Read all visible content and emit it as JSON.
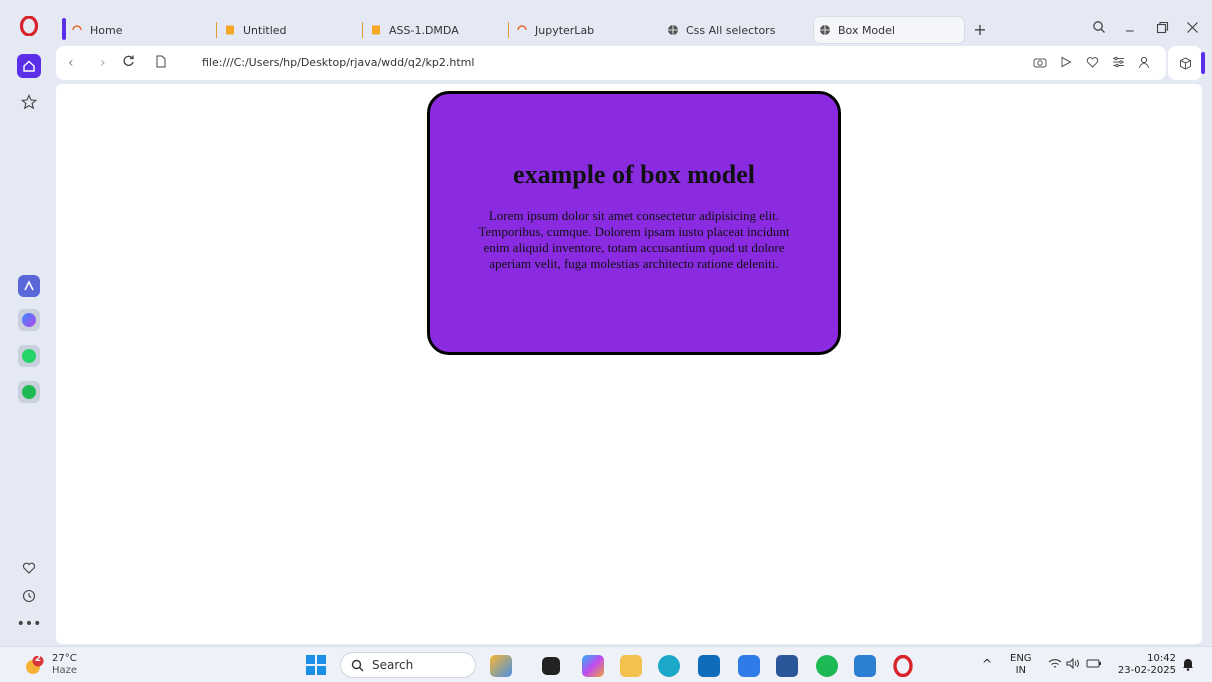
{
  "browser": {
    "tabs": [
      {
        "label": "Home"
      },
      {
        "label": "Untitled"
      },
      {
        "label": "ASS-1.DMDA"
      },
      {
        "label": "JupyterLab"
      },
      {
        "label": "Css All selectors"
      },
      {
        "label": "Box Model"
      }
    ],
    "new_tab": "+",
    "url": "file:///C:/Users/hp/Desktop/rjava/wdd/q2/kp2.html",
    "accent_color": "#5b2ee8"
  },
  "page": {
    "heading": "example of box model",
    "paragraph": "Lorem ipsum dolor sit amet consectetur adipisicing elit. Temporibus, cumque. Dolorem ipsam iusto placeat incidunt enim aliquid inventore, totam accusantium quod ut dolore aperiam velit, fuga molestias architecto ratione deleniti.",
    "box_color": "#8a2be2"
  },
  "taskbar": {
    "weather_temp": "27°C",
    "weather_desc": "Haze",
    "weather_badge": "2",
    "search_label": "Search",
    "lang_top": "ENG",
    "lang_bottom": "IN",
    "time": "10:42",
    "date": "23-02-2025"
  }
}
